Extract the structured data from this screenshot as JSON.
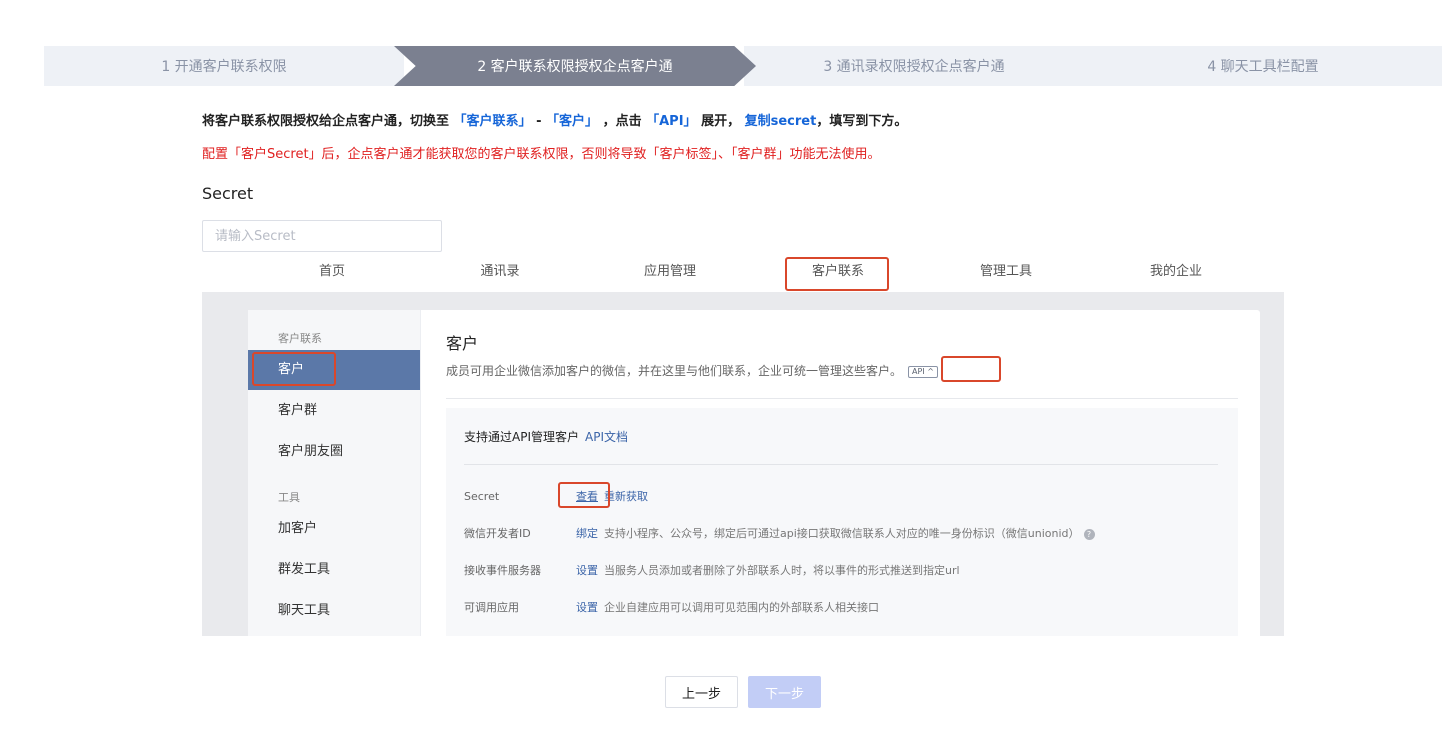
{
  "steps": [
    {
      "label": "1 开通客户联系权限"
    },
    {
      "label": "2 客户联系权限授权企点客户通"
    },
    {
      "label": "3 通讯录权限授权企点客户通"
    },
    {
      "label": "4 聊天工具栏配置"
    }
  ],
  "instruction": {
    "p1": "将客户联系权限授权给企点客户通，切换至",
    "k1": "「客户联系」",
    "dash": " - ",
    "k2": "「客户」",
    "p2": "，点击",
    "k3": "「API」",
    "p3": "展开，",
    "k4": "复制secret",
    "p4": "，填写到下方。",
    "warning": "配置「客户Secret」后，企点客户通才能获取您的客户联系权限，否则将导致「客户标签」、「客户群」功能无法使用。"
  },
  "secret": {
    "label": "Secret",
    "placeholder": "请输入Secret",
    "value": ""
  },
  "screenshot": {
    "topnav": [
      "首页",
      "通讯录",
      "应用管理",
      "客户联系",
      "管理工具",
      "我的企业"
    ],
    "sidebar": {
      "group1": "客户联系",
      "items1": [
        "客户",
        "客户群",
        "客户朋友圈"
      ],
      "group2": "工具",
      "items2": [
        "加客户",
        "群发工具",
        "聊天工具"
      ]
    },
    "title": "客户",
    "desc": "成员可用企业微信添加客户的微信，并在这里与他们联系，企业可统一管理这些客户。",
    "api_badge": "API ^",
    "api_header": "支持通过API管理客户",
    "api_doc": "API文档",
    "rows": [
      {
        "label": "Secret",
        "action1": "查看",
        "action2": "重新获取",
        "note": ""
      },
      {
        "label": "微信开发者ID",
        "action1": "绑定",
        "action2": "",
        "note": "支持小程序、公众号，绑定后可通过api接口获取微信联系人对应的唯一身份标识（微信unionid）"
      },
      {
        "label": "接收事件服务器",
        "action1": "设置",
        "action2": "",
        "note": "当服务人员添加或者删除了外部联系人时，将以事件的形式推送到指定url"
      },
      {
        "label": "可调用应用",
        "action1": "设置",
        "action2": "",
        "note": "企业自建应用可以调用可见范围内的外部联系人相关接口"
      }
    ],
    "help_icon": "?"
  },
  "buttons": {
    "prev": "上一步",
    "next": "下一步"
  },
  "colors": {
    "active_step": "#7b8090",
    "link_blue": "#1565d8",
    "warning_red": "#e02020",
    "highlight": "#d9472b",
    "sidebar_active": "#5b78a8"
  }
}
